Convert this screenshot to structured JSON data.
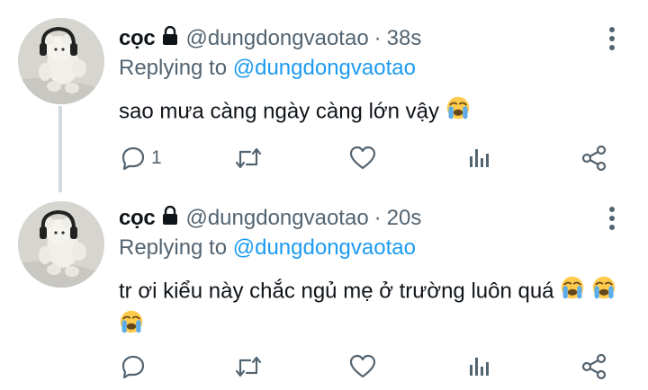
{
  "tweets": [
    {
      "name": "cọc",
      "handle": "@dungdongvaotao",
      "separator": "·",
      "time": "38s",
      "replying_prefix": "Replying to",
      "replying_to": "@dungdongvaotao",
      "text": "sao mưa càng ngày càng lớn vậy",
      "emojis": [
        "loudly-crying-face"
      ],
      "reply_count": "1"
    },
    {
      "name": "cọc",
      "handle": "@dungdongvaotao",
      "separator": "·",
      "time": "20s",
      "replying_prefix": "Replying to",
      "replying_to": "@dungdongvaotao",
      "text": "tr ơi kiểu này chắc ngủ mẹ ở trường luôn quá",
      "emojis": [
        "loudly-crying-face",
        "loudly-crying-face",
        "loudly-crying-face"
      ],
      "reply_count": ""
    }
  ],
  "icons": {
    "lock": "lock-icon",
    "more": "more-vertical-icon",
    "reply": "reply-icon",
    "retweet": "retweet-icon",
    "like": "heart-icon",
    "views": "analytics-icon",
    "share": "share-icon"
  },
  "colors": {
    "text": "#0f1419",
    "secondary": "#536471",
    "mention": "#1d9bf0",
    "thread_line": "#cfd9de"
  }
}
